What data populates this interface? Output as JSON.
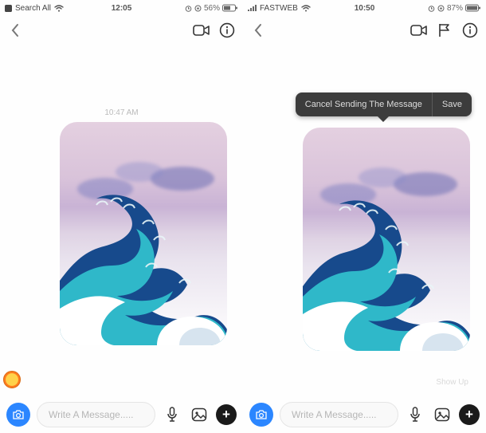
{
  "left": {
    "status": {
      "carrier": "Search All",
      "time": "12:05",
      "battery_pct": "56%"
    },
    "chat": {
      "timestamp": "10:47 AM",
      "image_alt": "The Great Wave artwork"
    },
    "composer": {
      "placeholder": "Write A Message....."
    }
  },
  "right": {
    "status": {
      "carrier": "FASTWEB",
      "time": "10:50",
      "battery_pct": "87%"
    },
    "popup": {
      "cancel": "Cancel Sending The Message",
      "save": "Save"
    },
    "chat": {
      "image_alt": "The Great Wave artwork",
      "show_up": "Show Up"
    },
    "composer": {
      "placeholder": "Write A Message....."
    }
  }
}
